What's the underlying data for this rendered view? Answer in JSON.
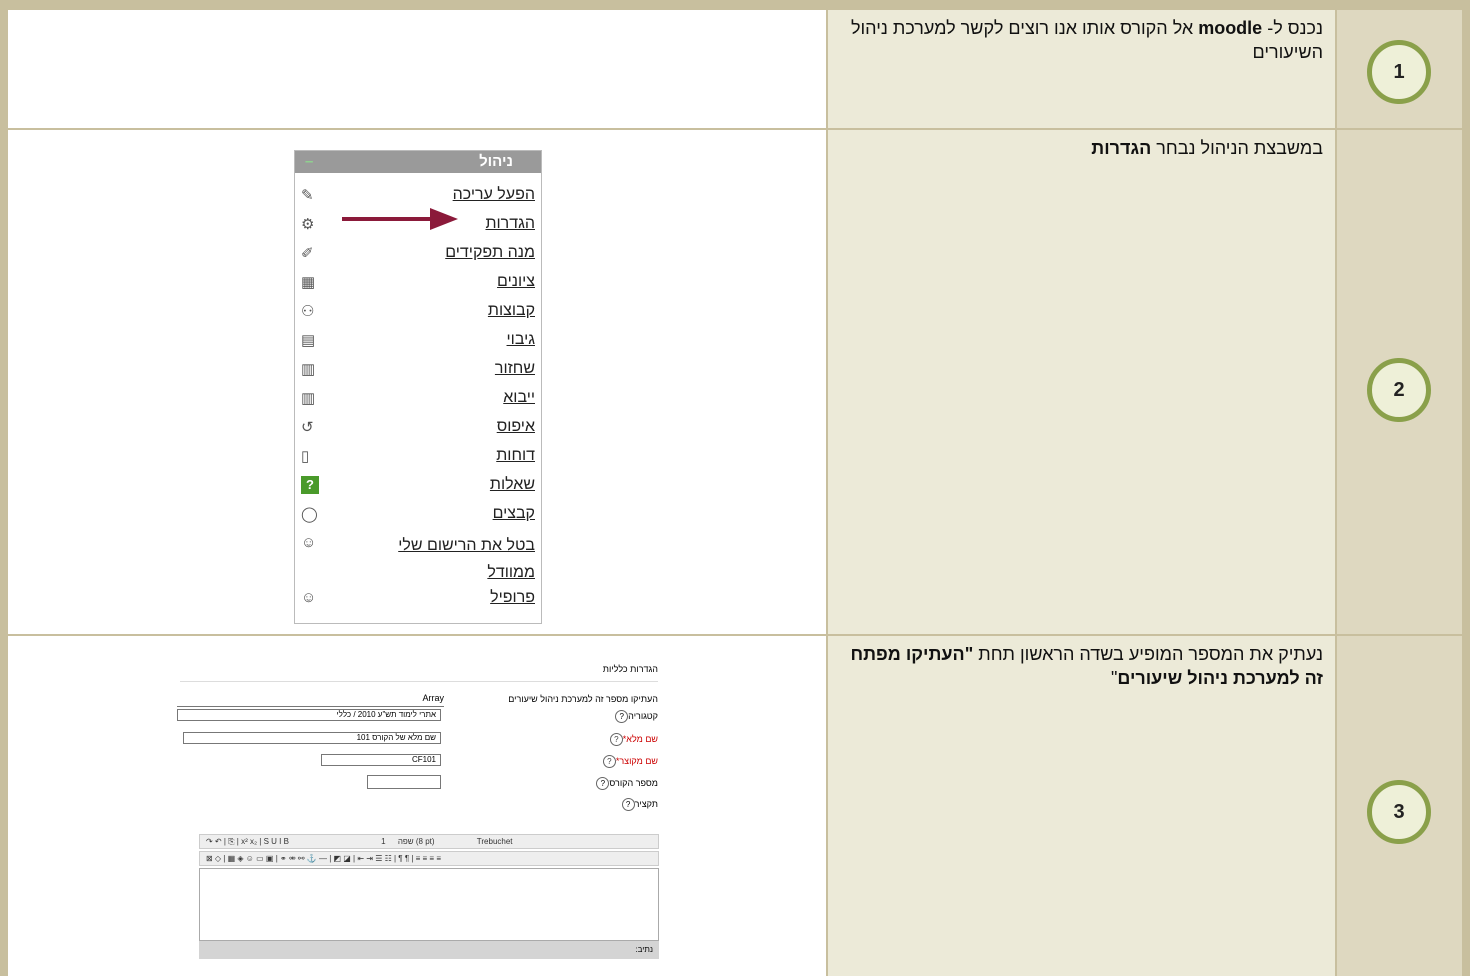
{
  "rows": [
    {
      "number": "1",
      "text_pre": "נכנס ל- ",
      "text_bold": "moodle",
      "text_post": " אל הקורס אותו אנו רוצים לקשר למערכת ניהול השיעורים"
    },
    {
      "number": "2",
      "text_pre": "במשבצת הניהול נבחר ",
      "text_bold": "הגדרות",
      "text_post": ""
    },
    {
      "number": "3",
      "text_pre": "נעתיק את המספר המופיע בשדה הראשון תחת ",
      "text_bold": "\"העתיקו מפתח זה למערכת ניהול שיעורים",
      "text_post": "\""
    }
  ],
  "admin_menu": {
    "title": "ניהול",
    "collapse": "–",
    "items": [
      {
        "label": "הפעל עריכה",
        "icon": "pencil-icon"
      },
      {
        "label": "הגדרות",
        "icon": "gear-icon"
      },
      {
        "label": "מנה תפקידים",
        "icon": "assign-roles-icon"
      },
      {
        "label": "ציונים",
        "icon": "grades-icon"
      },
      {
        "label": "קבוצות",
        "icon": "groups-icon"
      },
      {
        "label": "גיבוי",
        "icon": "backup-icon"
      },
      {
        "label": "שחזור",
        "icon": "restore-icon"
      },
      {
        "label": "ייבוא",
        "icon": "import-icon"
      },
      {
        "label": "איפוס",
        "icon": "reset-icon"
      },
      {
        "label": "דוחות",
        "icon": "reports-icon"
      },
      {
        "label": "שאלות",
        "icon": "questions-icon"
      },
      {
        "label": "קבצים",
        "icon": "files-icon"
      },
      {
        "label": "בטל את הרישום שלי ממוודל",
        "icon": "unenrol-icon"
      },
      {
        "label": "פרופיל",
        "icon": "profile-icon"
      }
    ]
  },
  "settings_form": {
    "section_title": "הגדרות כלליות",
    "key_label": "העתיקו מספר זה למערכת ניהול שיעורים",
    "key_value": "Array",
    "category_label": "קטגוריה",
    "category_value": "אתרי לימוד תש\"ע 2010 / כללי",
    "fullname_label": "שם מלא*",
    "fullname_value": "שם מלא של הקורס 101",
    "shortname_label": "שם מקוצר*",
    "shortname_value": "CF101",
    "idnumber_label": "מספר הקורס",
    "summary_label": "תקציר",
    "help": "?",
    "font_name": "Trebuchet",
    "font_size": "1 (8 pt)",
    "lang": "שפה",
    "path_label": "נתיב:"
  },
  "colors": {
    "table_border": "#c8bf9e",
    "number_bg": "#ded8c0",
    "text_bg": "#ecead8",
    "circle_ring": "#8aa04a",
    "arrow": "#8b1a3a"
  }
}
